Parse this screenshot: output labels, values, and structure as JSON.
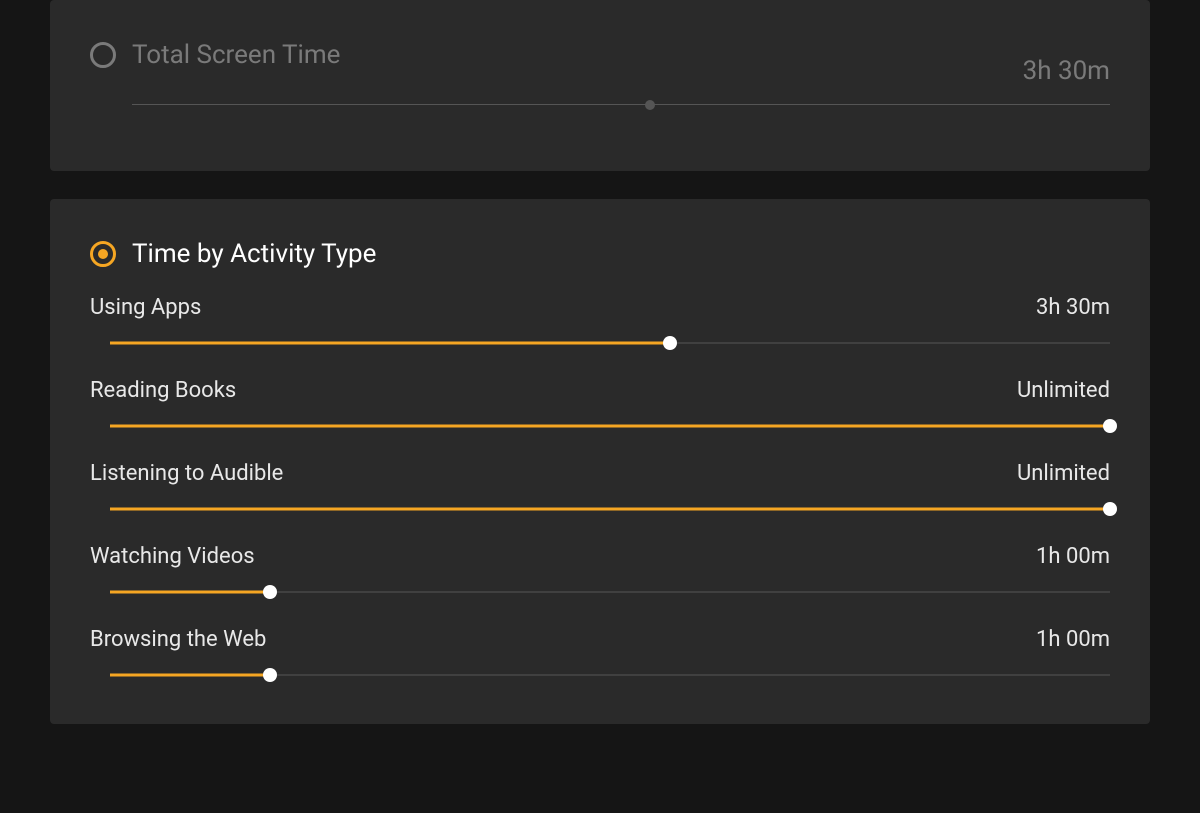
{
  "totalSection": {
    "title": "Total Screen Time",
    "value": "3h 30m",
    "percent": 53
  },
  "activitySection": {
    "title": "Time by Activity Type",
    "items": [
      {
        "name": "Using Apps",
        "value": "3h 30m",
        "percent": 56
      },
      {
        "name": "Reading Books",
        "value": "Unlimited",
        "percent": 100
      },
      {
        "name": "Listening to Audible",
        "value": "Unlimited",
        "percent": 100
      },
      {
        "name": "Watching Videos",
        "value": "1h 00m",
        "percent": 16
      },
      {
        "name": "Browsing the Web",
        "value": "1h 00m",
        "percent": 16
      }
    ]
  }
}
